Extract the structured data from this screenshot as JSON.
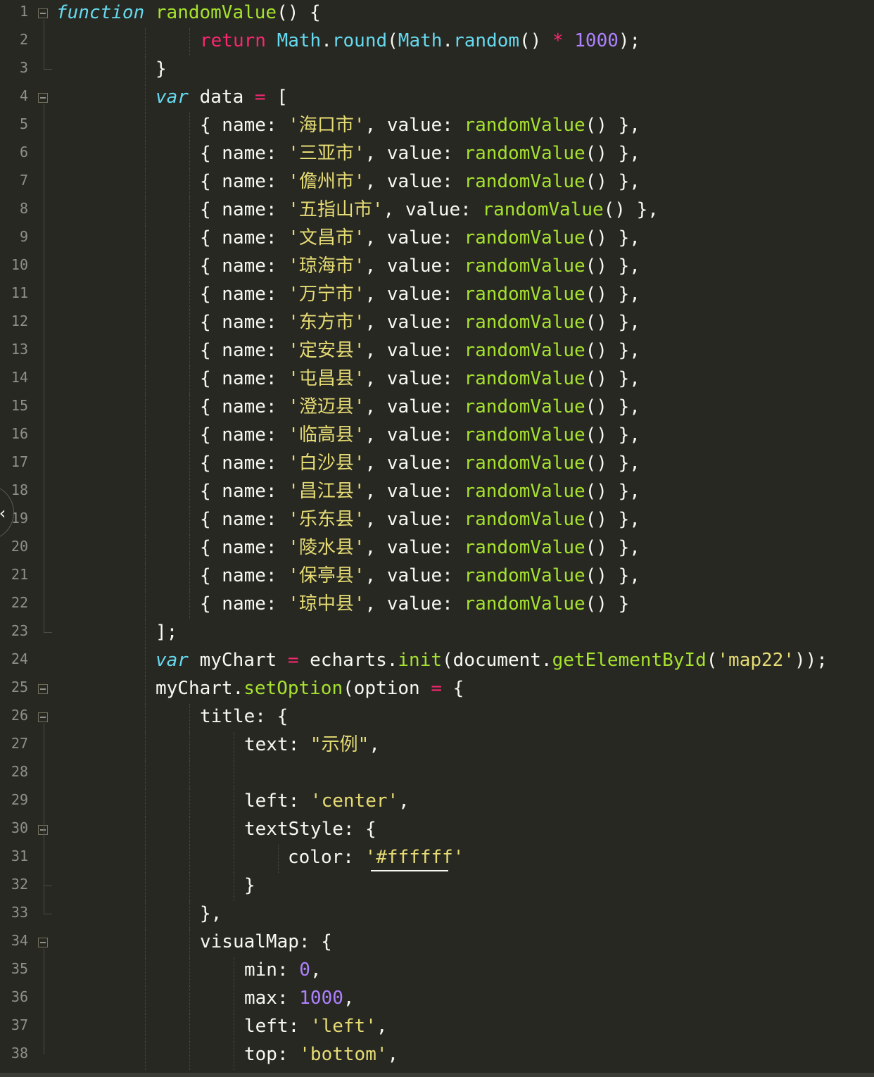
{
  "editor": {
    "theme_colors": {
      "background": "#272822",
      "keyword": "#f92672",
      "storage": "#66d9ef",
      "function": "#a6e22e",
      "string": "#e6db74",
      "number": "#ae81ff",
      "plain": "#f8f8f2",
      "line_number": "#90908a"
    },
    "side_tab_icon": "chevron-left-icon",
    "side_tab_glyph": "‹",
    "lines": [
      {
        "n": "1",
        "fold": true,
        "indent": 0,
        "tokens": [
          {
            "t": "function",
            "c": "storage-italic"
          },
          {
            "t": " ",
            "c": "plain"
          },
          {
            "t": "randomValue",
            "c": "function"
          },
          {
            "t": "() {",
            "c": "plain"
          }
        ]
      },
      {
        "n": "2",
        "fold": false,
        "indent": 3,
        "tokens": [
          {
            "t": "return",
            "c": "keyword"
          },
          {
            "t": " ",
            "c": "plain"
          },
          {
            "t": "Math",
            "c": "storage"
          },
          {
            "t": ".",
            "c": "plain"
          },
          {
            "t": "round",
            "c": "storage"
          },
          {
            "t": "(",
            "c": "plain"
          },
          {
            "t": "Math",
            "c": "storage"
          },
          {
            "t": ".",
            "c": "plain"
          },
          {
            "t": "random",
            "c": "storage"
          },
          {
            "t": "() ",
            "c": "plain"
          },
          {
            "t": "*",
            "c": "keyword"
          },
          {
            "t": " ",
            "c": "plain"
          },
          {
            "t": "1000",
            "c": "number"
          },
          {
            "t": ");",
            "c": "plain"
          }
        ]
      },
      {
        "n": "3",
        "fold": false,
        "indent": 2,
        "tokens": [
          {
            "t": "}",
            "c": "plain"
          }
        ]
      },
      {
        "n": "4",
        "fold": true,
        "indent": 2,
        "tokens": [
          {
            "t": "var",
            "c": "storage-italic"
          },
          {
            "t": " data ",
            "c": "plain"
          },
          {
            "t": "=",
            "c": "keyword"
          },
          {
            "t": " [",
            "c": "plain"
          }
        ]
      },
      {
        "n": "5",
        "fold": false,
        "indent": 3,
        "tokens": [
          {
            "t": "{ name: ",
            "c": "plain"
          },
          {
            "t": "'海口市'",
            "c": "string"
          },
          {
            "t": ", value: ",
            "c": "plain"
          },
          {
            "t": "randomValue",
            "c": "function"
          },
          {
            "t": "() },",
            "c": "plain"
          }
        ]
      },
      {
        "n": "6",
        "fold": false,
        "indent": 3,
        "tokens": [
          {
            "t": "{ name: ",
            "c": "plain"
          },
          {
            "t": "'三亚市'",
            "c": "string"
          },
          {
            "t": ", value: ",
            "c": "plain"
          },
          {
            "t": "randomValue",
            "c": "function"
          },
          {
            "t": "() },",
            "c": "plain"
          }
        ]
      },
      {
        "n": "7",
        "fold": false,
        "indent": 3,
        "tokens": [
          {
            "t": "{ name: ",
            "c": "plain"
          },
          {
            "t": "'儋州市'",
            "c": "string"
          },
          {
            "t": ", value: ",
            "c": "plain"
          },
          {
            "t": "randomValue",
            "c": "function"
          },
          {
            "t": "() },",
            "c": "plain"
          }
        ]
      },
      {
        "n": "8",
        "fold": false,
        "indent": 3,
        "tokens": [
          {
            "t": "{ name: ",
            "c": "plain"
          },
          {
            "t": "'五指山市'",
            "c": "string"
          },
          {
            "t": ", value: ",
            "c": "plain"
          },
          {
            "t": "randomValue",
            "c": "function"
          },
          {
            "t": "() },",
            "c": "plain"
          }
        ]
      },
      {
        "n": "9",
        "fold": false,
        "indent": 3,
        "tokens": [
          {
            "t": "{ name: ",
            "c": "plain"
          },
          {
            "t": "'文昌市'",
            "c": "string"
          },
          {
            "t": ", value: ",
            "c": "plain"
          },
          {
            "t": "randomValue",
            "c": "function"
          },
          {
            "t": "() },",
            "c": "plain"
          }
        ]
      },
      {
        "n": "10",
        "fold": false,
        "indent": 3,
        "tokens": [
          {
            "t": "{ name: ",
            "c": "plain"
          },
          {
            "t": "'琼海市'",
            "c": "string"
          },
          {
            "t": ", value: ",
            "c": "plain"
          },
          {
            "t": "randomValue",
            "c": "function"
          },
          {
            "t": "() },",
            "c": "plain"
          }
        ]
      },
      {
        "n": "11",
        "fold": false,
        "indent": 3,
        "tokens": [
          {
            "t": "{ name: ",
            "c": "plain"
          },
          {
            "t": "'万宁市'",
            "c": "string"
          },
          {
            "t": ", value: ",
            "c": "plain"
          },
          {
            "t": "randomValue",
            "c": "function"
          },
          {
            "t": "() },",
            "c": "plain"
          }
        ]
      },
      {
        "n": "12",
        "fold": false,
        "indent": 3,
        "tokens": [
          {
            "t": "{ name: ",
            "c": "plain"
          },
          {
            "t": "'东方市'",
            "c": "string"
          },
          {
            "t": ", value: ",
            "c": "plain"
          },
          {
            "t": "randomValue",
            "c": "function"
          },
          {
            "t": "() },",
            "c": "plain"
          }
        ]
      },
      {
        "n": "13",
        "fold": false,
        "indent": 3,
        "tokens": [
          {
            "t": "{ name: ",
            "c": "plain"
          },
          {
            "t": "'定安县'",
            "c": "string"
          },
          {
            "t": ", value: ",
            "c": "plain"
          },
          {
            "t": "randomValue",
            "c": "function"
          },
          {
            "t": "() },",
            "c": "plain"
          }
        ]
      },
      {
        "n": "14",
        "fold": false,
        "indent": 3,
        "tokens": [
          {
            "t": "{ name: ",
            "c": "plain"
          },
          {
            "t": "'屯昌县'",
            "c": "string"
          },
          {
            "t": ", value: ",
            "c": "plain"
          },
          {
            "t": "randomValue",
            "c": "function"
          },
          {
            "t": "() },",
            "c": "plain"
          }
        ]
      },
      {
        "n": "15",
        "fold": false,
        "indent": 3,
        "tokens": [
          {
            "t": "{ name: ",
            "c": "plain"
          },
          {
            "t": "'澄迈县'",
            "c": "string"
          },
          {
            "t": ", value: ",
            "c": "plain"
          },
          {
            "t": "randomValue",
            "c": "function"
          },
          {
            "t": "() },",
            "c": "plain"
          }
        ]
      },
      {
        "n": "16",
        "fold": false,
        "indent": 3,
        "tokens": [
          {
            "t": "{ name: ",
            "c": "plain"
          },
          {
            "t": "'临高县'",
            "c": "string"
          },
          {
            "t": ", value: ",
            "c": "plain"
          },
          {
            "t": "randomValue",
            "c": "function"
          },
          {
            "t": "() },",
            "c": "plain"
          }
        ]
      },
      {
        "n": "17",
        "fold": false,
        "indent": 3,
        "tokens": [
          {
            "t": "{ name: ",
            "c": "plain"
          },
          {
            "t": "'白沙县'",
            "c": "string"
          },
          {
            "t": ", value: ",
            "c": "plain"
          },
          {
            "t": "randomValue",
            "c": "function"
          },
          {
            "t": "() },",
            "c": "plain"
          }
        ]
      },
      {
        "n": "18",
        "fold": false,
        "indent": 3,
        "tokens": [
          {
            "t": "{ name: ",
            "c": "plain"
          },
          {
            "t": "'昌江县'",
            "c": "string"
          },
          {
            "t": ", value: ",
            "c": "plain"
          },
          {
            "t": "randomValue",
            "c": "function"
          },
          {
            "t": "() },",
            "c": "plain"
          }
        ]
      },
      {
        "n": "19",
        "fold": false,
        "indent": 3,
        "tokens": [
          {
            "t": "{ name: ",
            "c": "plain"
          },
          {
            "t": "'乐东县'",
            "c": "string"
          },
          {
            "t": ", value: ",
            "c": "plain"
          },
          {
            "t": "randomValue",
            "c": "function"
          },
          {
            "t": "() },",
            "c": "plain"
          }
        ]
      },
      {
        "n": "20",
        "fold": false,
        "indent": 3,
        "tokens": [
          {
            "t": "{ name: ",
            "c": "plain"
          },
          {
            "t": "'陵水县'",
            "c": "string"
          },
          {
            "t": ", value: ",
            "c": "plain"
          },
          {
            "t": "randomValue",
            "c": "function"
          },
          {
            "t": "() },",
            "c": "plain"
          }
        ]
      },
      {
        "n": "21",
        "fold": false,
        "indent": 3,
        "tokens": [
          {
            "t": "{ name: ",
            "c": "plain"
          },
          {
            "t": "'保亭县'",
            "c": "string"
          },
          {
            "t": ", value: ",
            "c": "plain"
          },
          {
            "t": "randomValue",
            "c": "function"
          },
          {
            "t": "() },",
            "c": "plain"
          }
        ]
      },
      {
        "n": "22",
        "fold": false,
        "indent": 3,
        "tokens": [
          {
            "t": "{ name: ",
            "c": "plain"
          },
          {
            "t": "'琼中县'",
            "c": "string"
          },
          {
            "t": ", value: ",
            "c": "plain"
          },
          {
            "t": "randomValue",
            "c": "function"
          },
          {
            "t": "() }",
            "c": "plain"
          }
        ]
      },
      {
        "n": "23",
        "fold": false,
        "indent": 2,
        "tokens": [
          {
            "t": "];",
            "c": "plain"
          }
        ]
      },
      {
        "n": "24",
        "fold": false,
        "indent": 2,
        "tokens": [
          {
            "t": "var",
            "c": "storage-italic"
          },
          {
            "t": " myChart ",
            "c": "plain"
          },
          {
            "t": "=",
            "c": "keyword"
          },
          {
            "t": " echarts.",
            "c": "plain"
          },
          {
            "t": "init",
            "c": "function"
          },
          {
            "t": "(document.",
            "c": "plain"
          },
          {
            "t": "getElementById",
            "c": "function"
          },
          {
            "t": "(",
            "c": "plain"
          },
          {
            "t": "'map22'",
            "c": "string"
          },
          {
            "t": "));",
            "c": "plain"
          }
        ]
      },
      {
        "n": "25",
        "fold": true,
        "indent": 2,
        "tokens": [
          {
            "t": "myChart.",
            "c": "plain"
          },
          {
            "t": "setOption",
            "c": "function"
          },
          {
            "t": "(option ",
            "c": "plain"
          },
          {
            "t": "=",
            "c": "keyword"
          },
          {
            "t": " {",
            "c": "plain"
          }
        ]
      },
      {
        "n": "26",
        "fold": true,
        "indent": 3,
        "tokens": [
          {
            "t": "title: {",
            "c": "plain"
          }
        ]
      },
      {
        "n": "27",
        "fold": false,
        "indent": 4,
        "tokens": [
          {
            "t": "text: ",
            "c": "plain"
          },
          {
            "t": "\"示例\"",
            "c": "string"
          },
          {
            "t": ",",
            "c": "plain"
          }
        ]
      },
      {
        "n": "28",
        "fold": false,
        "indent": 4,
        "tokens": []
      },
      {
        "n": "29",
        "fold": false,
        "indent": 4,
        "tokens": [
          {
            "t": "left: ",
            "c": "plain"
          },
          {
            "t": "'center'",
            "c": "string"
          },
          {
            "t": ",",
            "c": "plain"
          }
        ]
      },
      {
        "n": "30",
        "fold": true,
        "indent": 4,
        "tokens": [
          {
            "t": "textStyle: {",
            "c": "plain"
          }
        ]
      },
      {
        "n": "31",
        "fold": false,
        "indent": 5,
        "tokens": [
          {
            "t": "color: ",
            "c": "plain"
          },
          {
            "t": "'#ffffff'",
            "c": "string"
          }
        ]
      },
      {
        "n": "32",
        "fold": false,
        "indent": 4,
        "tokens": [
          {
            "t": "}",
            "c": "plain"
          }
        ]
      },
      {
        "n": "33",
        "fold": false,
        "indent": 3,
        "tokens": [
          {
            "t": "},",
            "c": "plain"
          }
        ]
      },
      {
        "n": "34",
        "fold": true,
        "indent": 3,
        "tokens": [
          {
            "t": "visualMap: {",
            "c": "plain"
          }
        ]
      },
      {
        "n": "35",
        "fold": false,
        "indent": 4,
        "tokens": [
          {
            "t": "min: ",
            "c": "plain"
          },
          {
            "t": "0",
            "c": "number"
          },
          {
            "t": ",",
            "c": "plain"
          }
        ]
      },
      {
        "n": "36",
        "fold": false,
        "indent": 4,
        "tokens": [
          {
            "t": "max: ",
            "c": "plain"
          },
          {
            "t": "1000",
            "c": "number"
          },
          {
            "t": ",",
            "c": "plain"
          }
        ]
      },
      {
        "n": "37",
        "fold": false,
        "indent": 4,
        "tokens": [
          {
            "t": "left: ",
            "c": "plain"
          },
          {
            "t": "'left'",
            "c": "string"
          },
          {
            "t": ",",
            "c": "plain"
          }
        ]
      },
      {
        "n": "38",
        "fold": false,
        "indent": 4,
        "tokens": [
          {
            "t": "top: ",
            "c": "plain"
          },
          {
            "t": "'bottom'",
            "c": "string"
          },
          {
            "t": ",",
            "c": "plain"
          }
        ]
      }
    ]
  }
}
